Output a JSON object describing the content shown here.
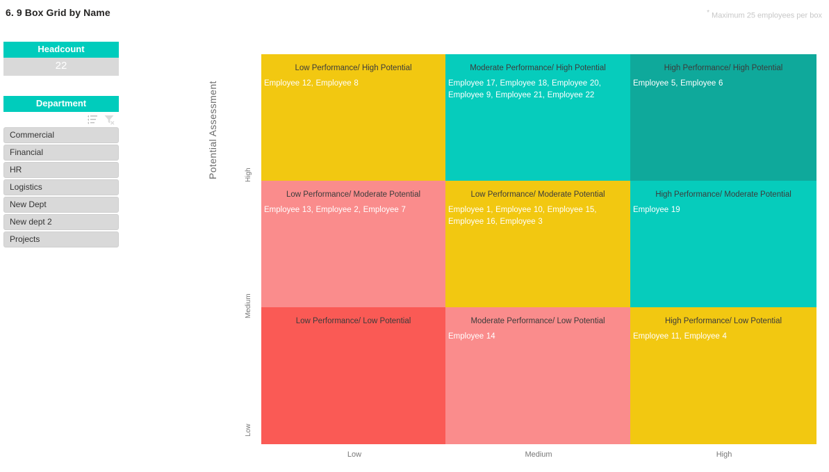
{
  "header": {
    "title": "6. 9 Box Grid by Name",
    "note_asterisk": "*",
    "note": " Maximum 25 employees per box"
  },
  "headcount_card": {
    "label": "Headcount",
    "value": "22",
    "header_color": "#00CCBC",
    "value_bg": "#D9D9D9"
  },
  "department_slicer": {
    "title": "Department",
    "sort_icon": "sort-list-icon",
    "clear_filter_icon": "clear-filter-icon",
    "items": [
      {
        "label": "Commercial"
      },
      {
        "label": "Financial"
      },
      {
        "label": "HR"
      },
      {
        "label": "Logistics"
      },
      {
        "label": "New Dept"
      },
      {
        "label": "New dept 2"
      },
      {
        "label": "Projects"
      }
    ]
  },
  "chart_data": {
    "type": "heatmap",
    "title": "6. 9 Box Grid by Name",
    "xlabel": "",
    "ylabel": "Potential Assessment",
    "x_tick_labels": [
      "Low",
      "Medium",
      "High"
    ],
    "y_tick_labels": [
      "High",
      "Medium",
      "Low"
    ],
    "legend": "none",
    "grid": false,
    "cells": [
      {
        "row": "High",
        "col": "Low",
        "title": "Low Performance/ High Potential",
        "names": "Employee 12, Employee 8",
        "count": 2,
        "color": "#F2C811"
      },
      {
        "row": "High",
        "col": "Medium",
        "title": "Moderate Performance/ High Potential",
        "names": "Employee 17, Employee 18, Employee 20, Employee 9, Employee 21, Employee 22",
        "count": 6,
        "color": "#06CCBC"
      },
      {
        "row": "High",
        "col": "High",
        "title": "High Performance/ High Potential",
        "names": "Employee 5, Employee 6",
        "count": 2,
        "color": "#0FA99B"
      },
      {
        "row": "Medium",
        "col": "Low",
        "title": "Low Performance/ Moderate Potential",
        "names": "Employee 13, Employee 2, Employee 7",
        "count": 3,
        "color": "#FA8C8C"
      },
      {
        "row": "Medium",
        "col": "Medium",
        "title": "Low Performance/ Moderate Potential",
        "names": "Employee 1, Employee 10, Employee 15, Employee 16, Employee 3",
        "count": 5,
        "color": "#F2C811"
      },
      {
        "row": "Medium",
        "col": "High",
        "title": "High Performance/ Moderate Potential",
        "names": "Employee 19",
        "count": 1,
        "color": "#06CCBC"
      },
      {
        "row": "Low",
        "col": "Low",
        "title": "Low Performance/ Low Potential",
        "names": "",
        "count": 0,
        "color": "#FA5A55"
      },
      {
        "row": "Low",
        "col": "Medium",
        "title": "Moderate Performance/ Low Potential",
        "names": "Employee 14",
        "count": 1,
        "color": "#FA8C8C"
      },
      {
        "row": "Low",
        "col": "High",
        "title": "High Performance/ Low Potential",
        "names": "Employee 11, Employee 4",
        "count": 2,
        "color": "#F2C811"
      }
    ]
  }
}
